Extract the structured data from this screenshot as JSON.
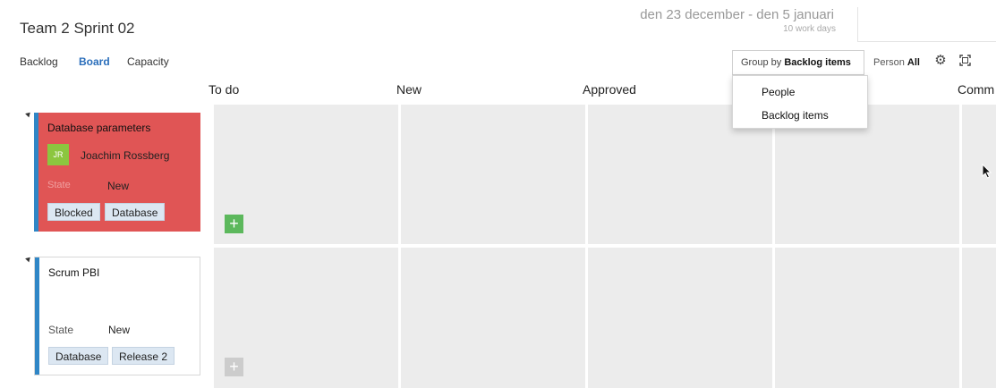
{
  "header": {
    "title": "Team 2 Sprint 02",
    "date_range": "den 23 december - den 5 januari",
    "work_days": "10 work days"
  },
  "nav": {
    "backlog": "Backlog",
    "board": "Board",
    "capacity": "Capacity"
  },
  "toolbar": {
    "group_by_label": "Group by",
    "group_by_value": "Backlog items",
    "person_label": "Person",
    "person_value": "All",
    "settings_icon": "gear-icon",
    "fullscreen_icon": "fullscreen-icon"
  },
  "group_by_options": [
    "People",
    "Backlog items"
  ],
  "columns": [
    "To do",
    "New",
    "Approved",
    "",
    "Comm"
  ],
  "cards": [
    {
      "title": "Database parameters",
      "assignee_initials": "JR",
      "assignee": "Joachim Rossberg",
      "state_label": "State",
      "state_value": "New",
      "tags": [
        "Blocked",
        "Database"
      ],
      "color": "#e05555"
    },
    {
      "title": "Scrum PBI",
      "state_label": "State",
      "state_value": "New",
      "tags": [
        "Database",
        "Release 2"
      ],
      "color": "#ffffff"
    }
  ],
  "add_button_label": "+",
  "colors": {
    "accent": "#2a6ebb",
    "card_bar": "#2f86c6",
    "blocked_card": "#e05555",
    "add_active": "#5cb85c",
    "add_inactive": "#cccccc",
    "avatar": "#8cc63f"
  }
}
